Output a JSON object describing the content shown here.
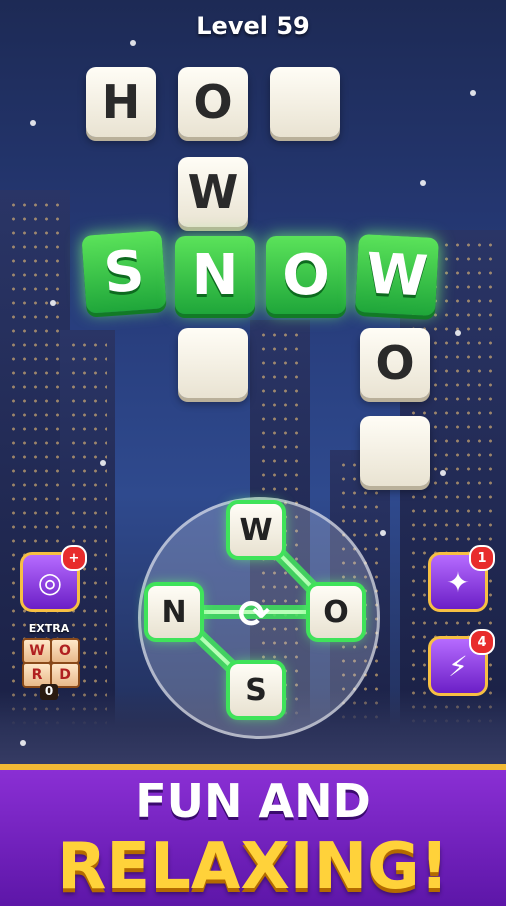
{
  "header": {
    "level_label": "Level 59"
  },
  "crossword": {
    "how_tiles": [
      "H",
      "O",
      ""
    ],
    "how_vertical": [
      "W"
    ],
    "snow_tiles": [
      "S",
      "N",
      "O",
      "W"
    ],
    "below_n": [
      ""
    ],
    "below_w": [
      "O",
      ""
    ]
  },
  "wheel": {
    "letters": {
      "top": "W",
      "left": "N",
      "right": "O",
      "bottom": "S"
    },
    "shuffle_icon": "shuffle-icon"
  },
  "powerups": {
    "target": {
      "icon": "target-icon",
      "badge": "+"
    },
    "wand": {
      "icon": "magic-wand-icon",
      "badge": "1"
    },
    "lightning": {
      "icon": "lightning-icon",
      "badge": "4"
    }
  },
  "extra_word": {
    "label": "EXTRA",
    "tiles": [
      "W",
      "O",
      "R",
      "D"
    ],
    "count": "0"
  },
  "banner": {
    "line1": "FUN AND",
    "line2": "RELAXING!"
  },
  "colors": {
    "accent_green": "#2fcf48",
    "banner_purple": "#6b1fc6",
    "banner_gold": "#ffd23a"
  }
}
